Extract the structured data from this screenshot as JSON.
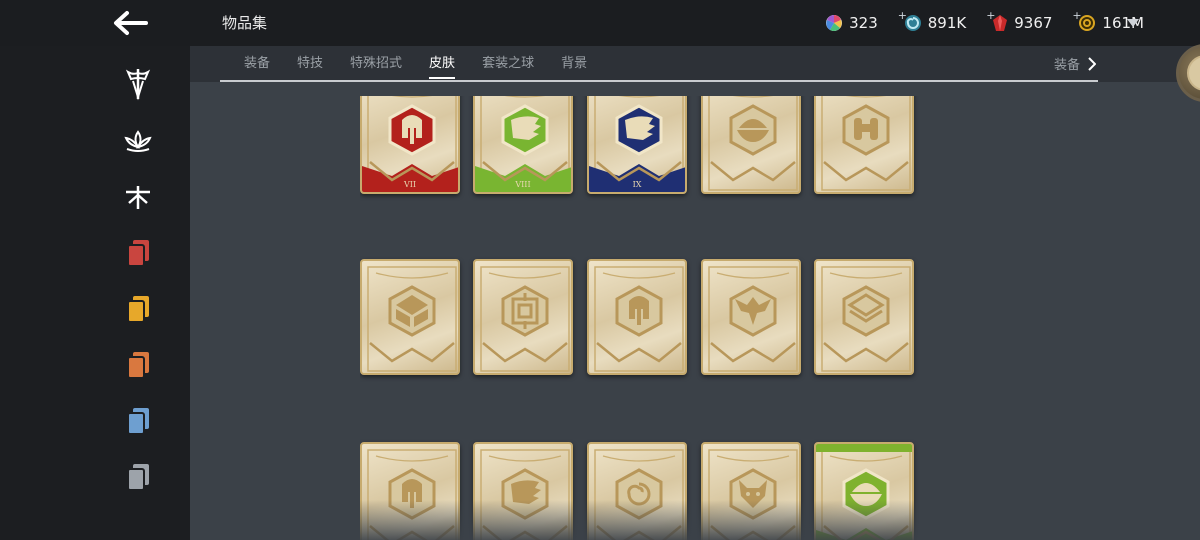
{
  "header": {
    "title": "物品集",
    "back_icon": "arrow-left-icon"
  },
  "currencies": [
    {
      "name": "rainbow-gem-icon",
      "value": "323",
      "plus": false
    },
    {
      "name": "blue-swirl-icon",
      "value": "891K",
      "plus": true
    },
    {
      "name": "red-crystal-icon",
      "value": "9367",
      "plus": true
    },
    {
      "name": "gold-coin-icon",
      "value": "161M",
      "plus": true
    }
  ],
  "tabs": [
    {
      "label": "装备",
      "active": false
    },
    {
      "label": "特技",
      "active": false
    },
    {
      "label": "特殊招式",
      "active": false
    },
    {
      "label": "皮肤",
      "active": true
    },
    {
      "label": "套装之球",
      "active": false
    },
    {
      "label": "背景",
      "active": false
    }
  ],
  "tab_right": {
    "label": "装备",
    "icon": "chevron-right-icon"
  },
  "sidebar": [
    {
      "icon": "sword-crest-icon",
      "color": "#ffffff"
    },
    {
      "icon": "lotus-icon",
      "color": "#ffffff"
    },
    {
      "icon": "dragonfly-icon",
      "color": "#ffffff"
    },
    {
      "icon": "card-stack-red-icon",
      "color": "#c9453f"
    },
    {
      "icon": "card-stack-gold-icon",
      "color": "#e7a82a"
    },
    {
      "icon": "card-stack-orange-icon",
      "color": "#d9783f"
    },
    {
      "icon": "card-stack-blue-icon",
      "color": "#6e9fd0"
    },
    {
      "icon": "card-stack-gray-icon",
      "color": "#9da3aa"
    }
  ],
  "cards": [
    {
      "icon": "spartan-helmet-icon",
      "numeral": "VII",
      "accent": "#b3211c"
    },
    {
      "icon": "wing-badge-icon",
      "numeral": "VIII",
      "accent": "#79b531"
    },
    {
      "icon": "wing-badge-icon",
      "numeral": "IX",
      "accent": "#1f2f73"
    },
    {
      "icon": "bowl-icon",
      "numeral": "",
      "accent": ""
    },
    {
      "icon": "scroll-icon",
      "numeral": "",
      "accent": ""
    },
    {
      "icon": "cube-glyph-icon",
      "numeral": "",
      "accent": ""
    },
    {
      "icon": "maze-glyph-icon",
      "numeral": "",
      "accent": ""
    },
    {
      "icon": "spartan-helmet-icon",
      "numeral": "",
      "accent": ""
    },
    {
      "icon": "phoenix-icon",
      "numeral": "",
      "accent": ""
    },
    {
      "icon": "layered-diamond-icon",
      "numeral": "",
      "accent": ""
    },
    {
      "icon": "spartan-helmet-icon",
      "numeral": "",
      "accent": ""
    },
    {
      "icon": "wing-badge-icon",
      "numeral": "",
      "accent": ""
    },
    {
      "icon": "spiral-icon",
      "numeral": "",
      "accent": ""
    },
    {
      "icon": "demon-mask-icon",
      "numeral": "",
      "accent": ""
    },
    {
      "icon": "bowl-icon",
      "numeral": "",
      "accent": "#7fb22e"
    }
  ]
}
